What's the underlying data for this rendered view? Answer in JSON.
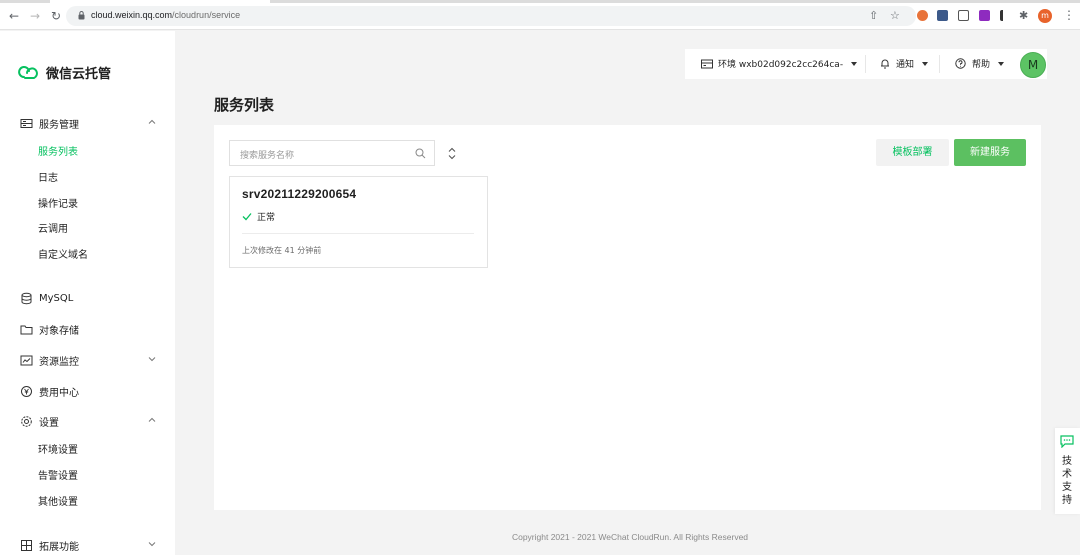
{
  "browser": {
    "url_host": "cloud.weixin.qq.com",
    "url_path": "/cloudrun/service",
    "profile_initial": "m"
  },
  "brand": {
    "name": "微信云托管"
  },
  "sidebar": {
    "service_mgmt": "服务管理",
    "sub_service": [
      "服务列表",
      "日志",
      "操作记录",
      "云调用",
      "自定义域名"
    ],
    "mysql": "MySQL",
    "object_storage": "对象存储",
    "resource_monitor": "资源监控",
    "billing": "费用中心",
    "settings": "设置",
    "sub_settings": [
      "环境设置",
      "告警设置",
      "其他设置"
    ],
    "extensions": "拓展功能"
  },
  "topbar": {
    "env_label": "环境 wxb02d092c2cc264ca-",
    "notify_label": "通知",
    "help_label": "帮助",
    "avatar_initial": "M"
  },
  "main": {
    "title": "服务列表",
    "search_placeholder": "搜索服务名称",
    "template_button": "模板部署",
    "new_button": "新建服务",
    "service": {
      "name": "srv20211229200654",
      "status": "正常",
      "modified": "上次修改在 41 分钟前"
    }
  },
  "footer": {
    "copyright": "Copyright 2021 - 2021 WeChat CloudRun. All Rights Reserved"
  },
  "support": {
    "label": "技术支持"
  },
  "colors": {
    "accent": "#07c160",
    "button_green": "#5cc061",
    "avatar": "#5cc364"
  }
}
